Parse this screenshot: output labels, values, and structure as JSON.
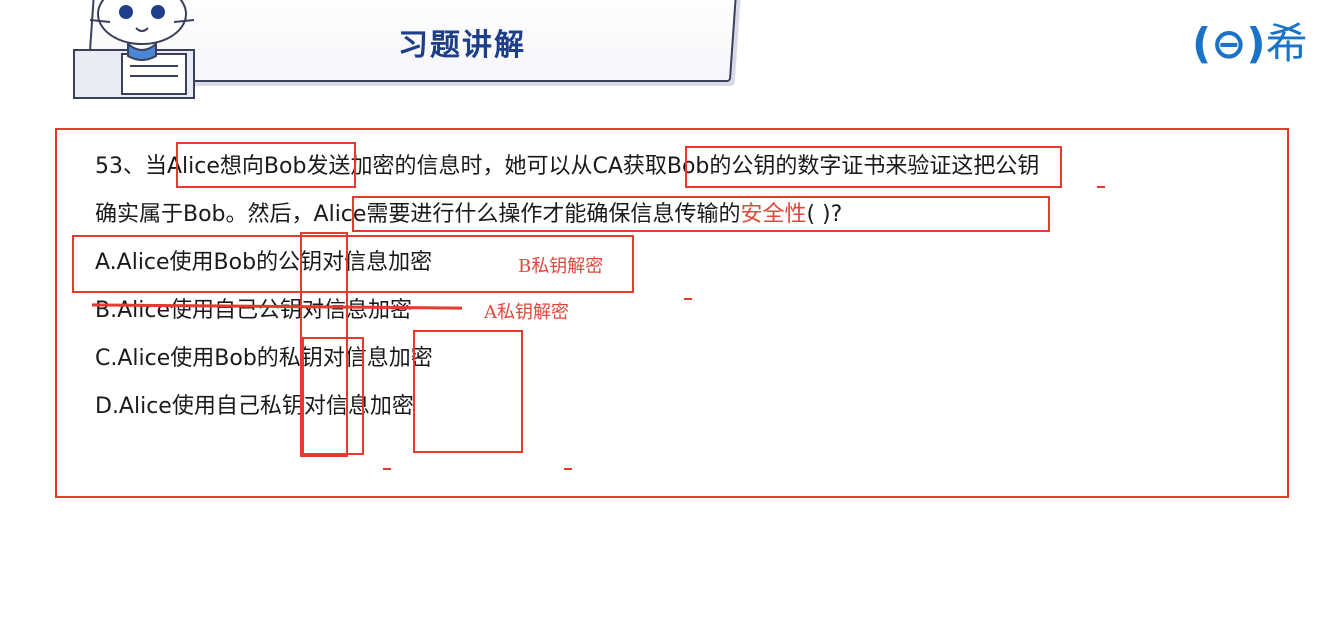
{
  "header": {
    "title": "习题讲解",
    "brand_text": "希"
  },
  "question": {
    "line1": {
      "num": "53、当",
      "hl1": "Alice想向Bob",
      "mid": "发送加密的信息时，她可以从",
      "hl2": "CA获取Bob的公钥的数字证书来",
      "tail": "验证这把公钥"
    },
    "line2": {
      "pre": "确实属于Bob。然后，",
      "main": "Alice需要进行什么操作才能确保信息传输的",
      "red": "安全性",
      "end": "(  )?"
    },
    "options": [
      {
        "text": "A.Alice使用Bob的公钥对信息加密",
        "note": "B私钥解密"
      },
      {
        "text": "B.Alice使用自己公钥对信息加密",
        "note": "A私钥解密"
      },
      {
        "text": "C.Alice使用Bob的私钥对信息加密",
        "note": ""
      },
      {
        "text": "D.Alice使用自己私钥对信息加密",
        "note": ""
      }
    ]
  },
  "colors": {
    "annotation_red": "#e63a2e",
    "title_blue": "#1d3f8a",
    "brand_blue": "#1b73c8"
  }
}
